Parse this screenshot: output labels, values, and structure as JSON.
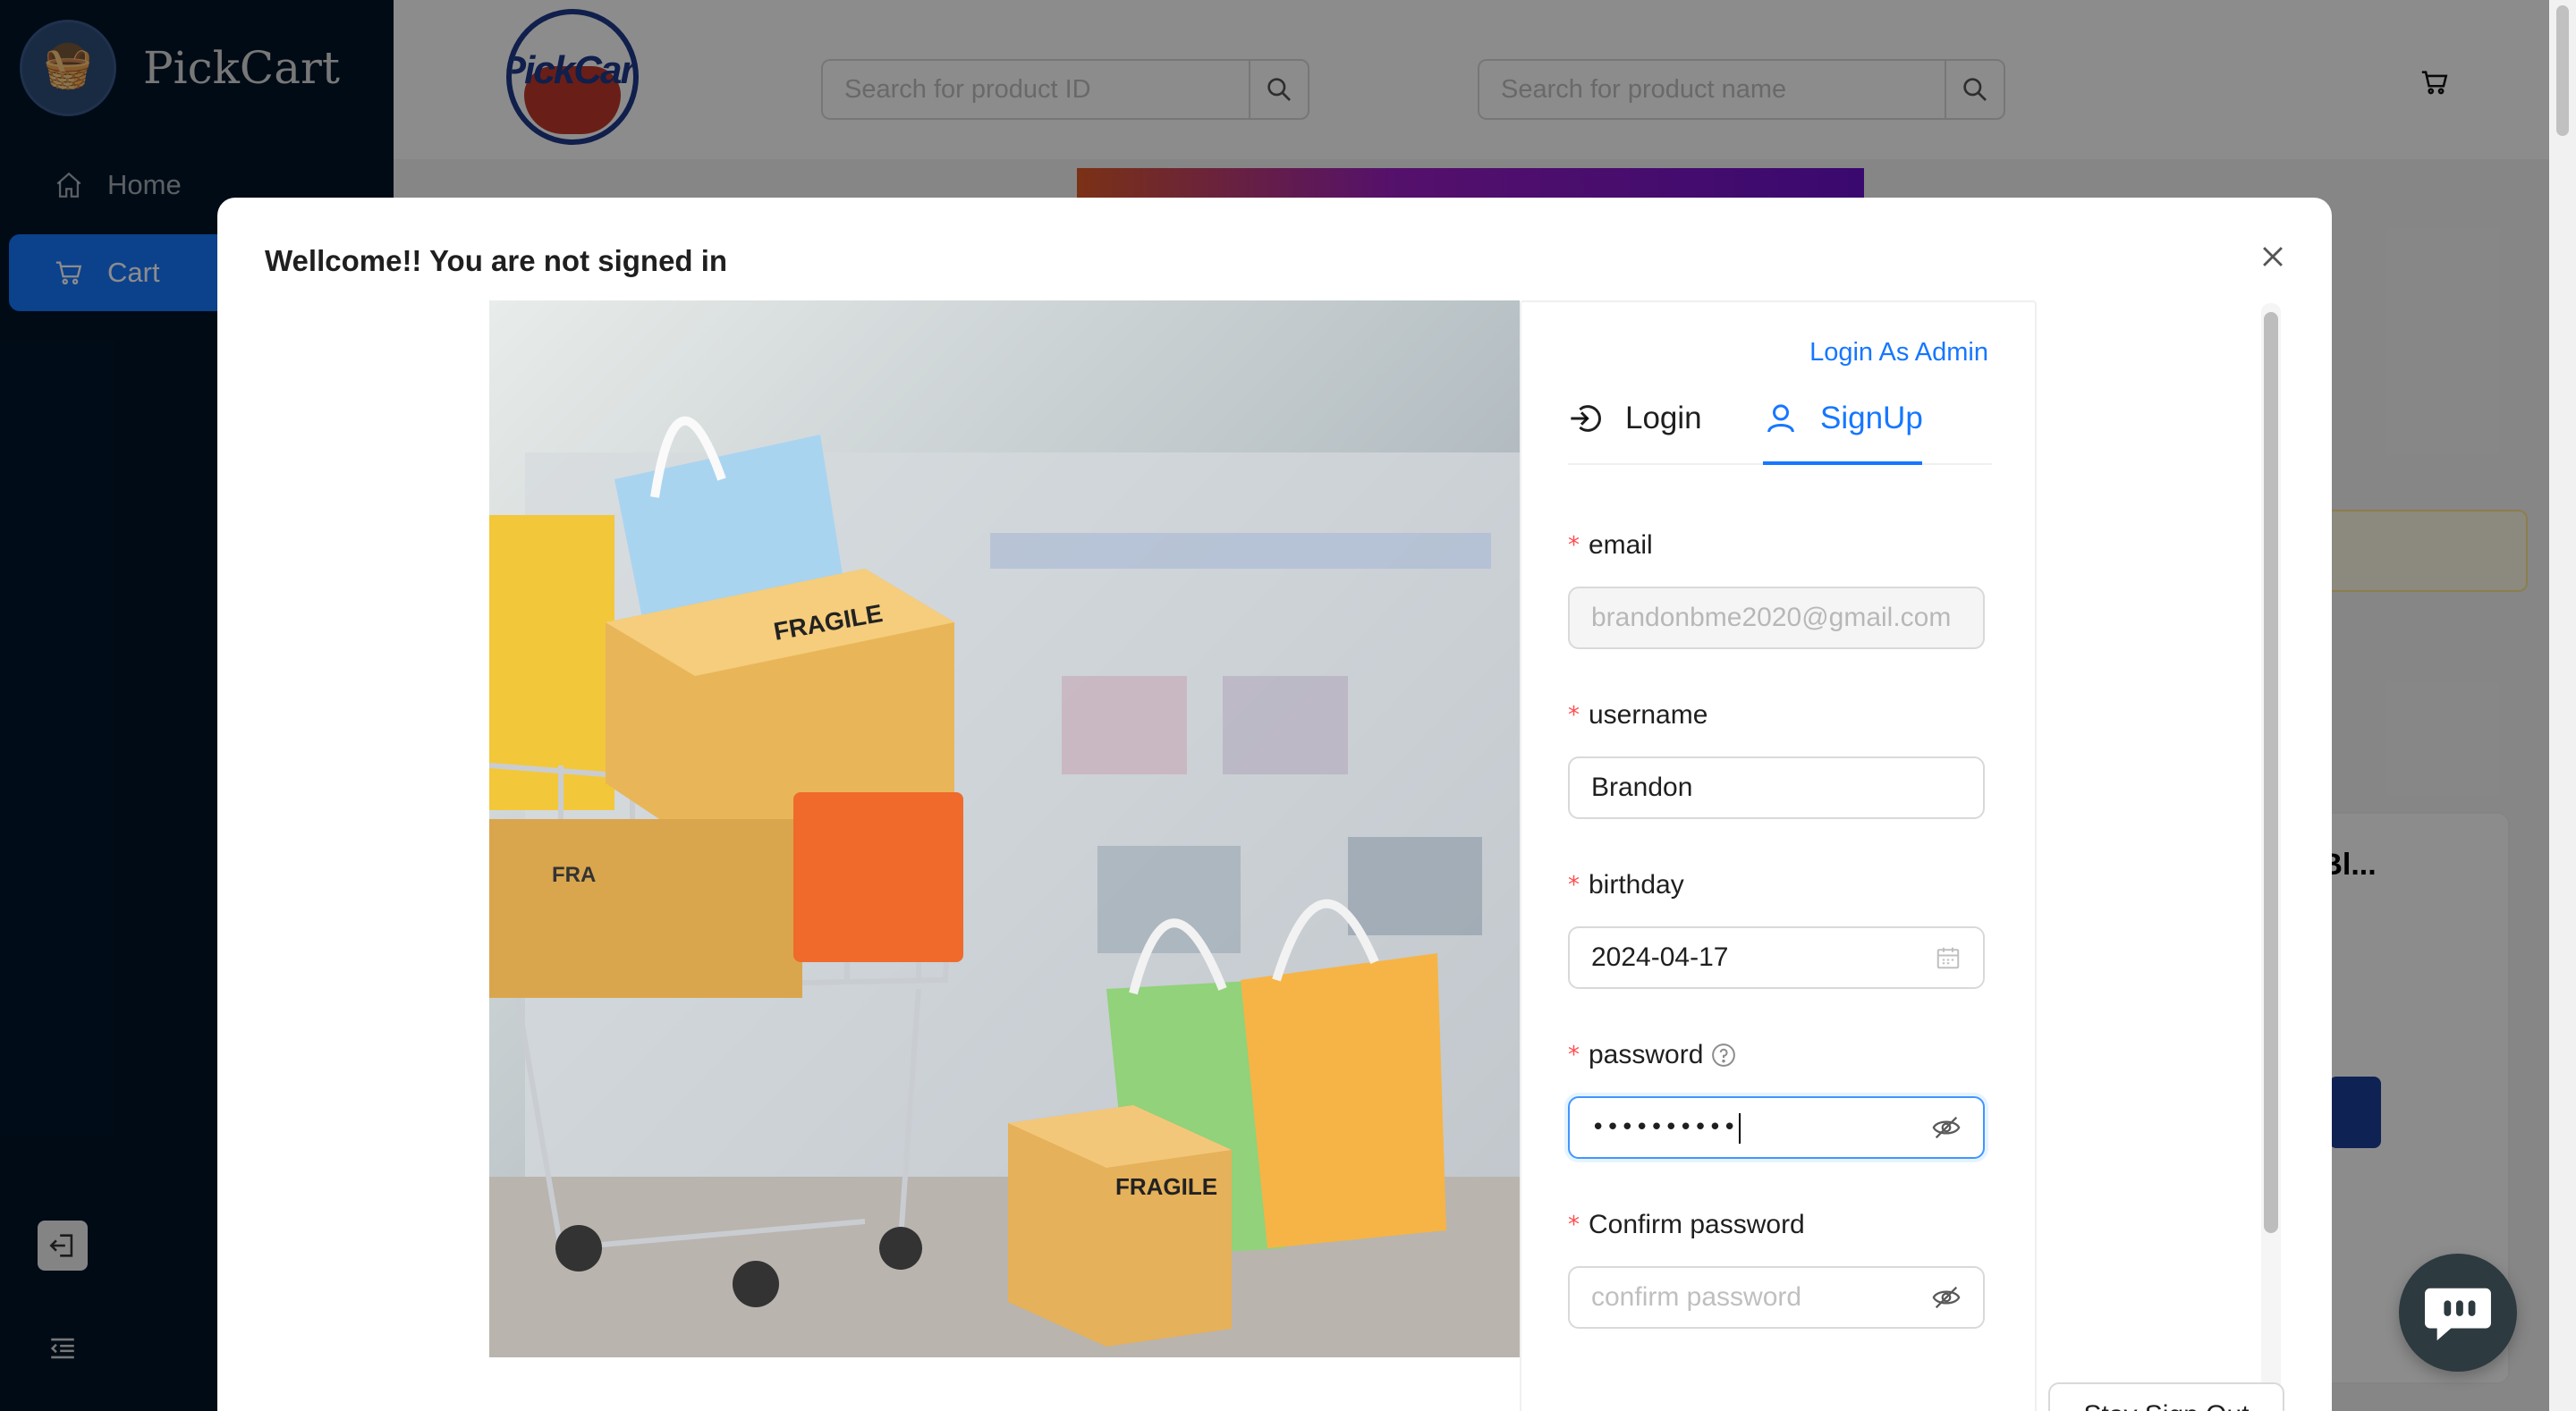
{
  "sidebar": {
    "brand_name": "PickCart",
    "items": [
      {
        "label": "Home",
        "icon": "home-icon"
      },
      {
        "label": "Cart",
        "icon": "cart-icon",
        "active": true
      }
    ],
    "bottom_icons": [
      "logout-icon",
      "menu-fold-icon"
    ]
  },
  "header": {
    "logo_text": "PickCart",
    "search_id": {
      "placeholder": "Search for product ID",
      "icon": "search-icon"
    },
    "search_name": {
      "placeholder": "Search for product name",
      "icon": "search-icon"
    },
    "cart_icon": "cart-icon"
  },
  "background": {
    "card_title": "c Bl..."
  },
  "modal": {
    "title": "Wellcome!! You are not signed in",
    "admin_link": "Login As Admin",
    "tabs": [
      {
        "label": "Login",
        "icon": "login-icon",
        "active": false
      },
      {
        "label": "SignUp",
        "icon": "user-icon",
        "active": true
      }
    ],
    "fields": {
      "email": {
        "label": "email",
        "value": "brandonbme2020@gmail.com",
        "disabled": true
      },
      "username": {
        "label": "username",
        "value": "Brandon"
      },
      "birthday": {
        "label": "birthday",
        "value": "2024-04-17",
        "icon": "calendar-icon"
      },
      "password": {
        "label": "password",
        "value": "••••••••••",
        "help_icon": "question-circle-icon",
        "toggle_icon": "eye-invisible-icon",
        "focused": true
      },
      "confirm_password": {
        "label": "Confirm password",
        "placeholder": "confirm password",
        "toggle_icon": "eye-invisible-icon"
      }
    },
    "footer_button": "Stay Sign Out"
  },
  "colors": {
    "primary": "#1677ff",
    "sidebar_bg": "#001529",
    "required": "#ff4d4f"
  }
}
